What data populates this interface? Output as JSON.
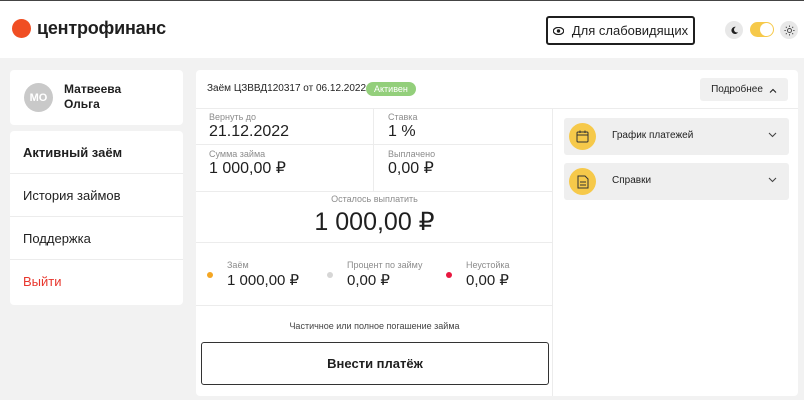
{
  "brand": {
    "name": "центрофинанс",
    "color": "#f04e23"
  },
  "header": {
    "accessibility_label": "Для слабовидящих",
    "accent": "#f6c94a"
  },
  "profile": {
    "initials": "МО",
    "last_name": "Матвеева",
    "first_name": "Ольга"
  },
  "menu": [
    {
      "label": "Активный заём"
    },
    {
      "label": "История займов"
    },
    {
      "label": "Поддержка"
    },
    {
      "label": "Выйти"
    }
  ],
  "loan": {
    "title": "Заём ЦЗВВД120317 от 06.12.2022",
    "status": "Активен",
    "status_color": "#93cf7b",
    "more_label": "Подробнее",
    "return_label": "Вернуть до",
    "return_value": "21.12.2022",
    "rate_label": "Ставка",
    "rate_value": "1 %",
    "amount_label": "Сумма займа",
    "amount_value": "1 000,00 ₽",
    "paid_label": "Выплачено",
    "paid_value": "0,00 ₽",
    "remain_label": "Осталось выплатить",
    "remain_value": "1 000,00 ₽",
    "breakdown": [
      {
        "label": "Заём",
        "value": "1 000,00 ₽",
        "color": "#f4a623"
      },
      {
        "label": "Процент по займу",
        "value": "0,00 ₽",
        "color": "#d6d6d6"
      },
      {
        "label": "Неустойка",
        "value": "0,00 ₽",
        "color": "#e8173f"
      }
    ],
    "partial_note": "Частичное или полное погашение займа",
    "pay_label": "Внести платёж"
  },
  "accordions": [
    {
      "title": "График платежей",
      "icon": "calendar-icon"
    },
    {
      "title": "Справки",
      "icon": "document-icon"
    }
  ]
}
